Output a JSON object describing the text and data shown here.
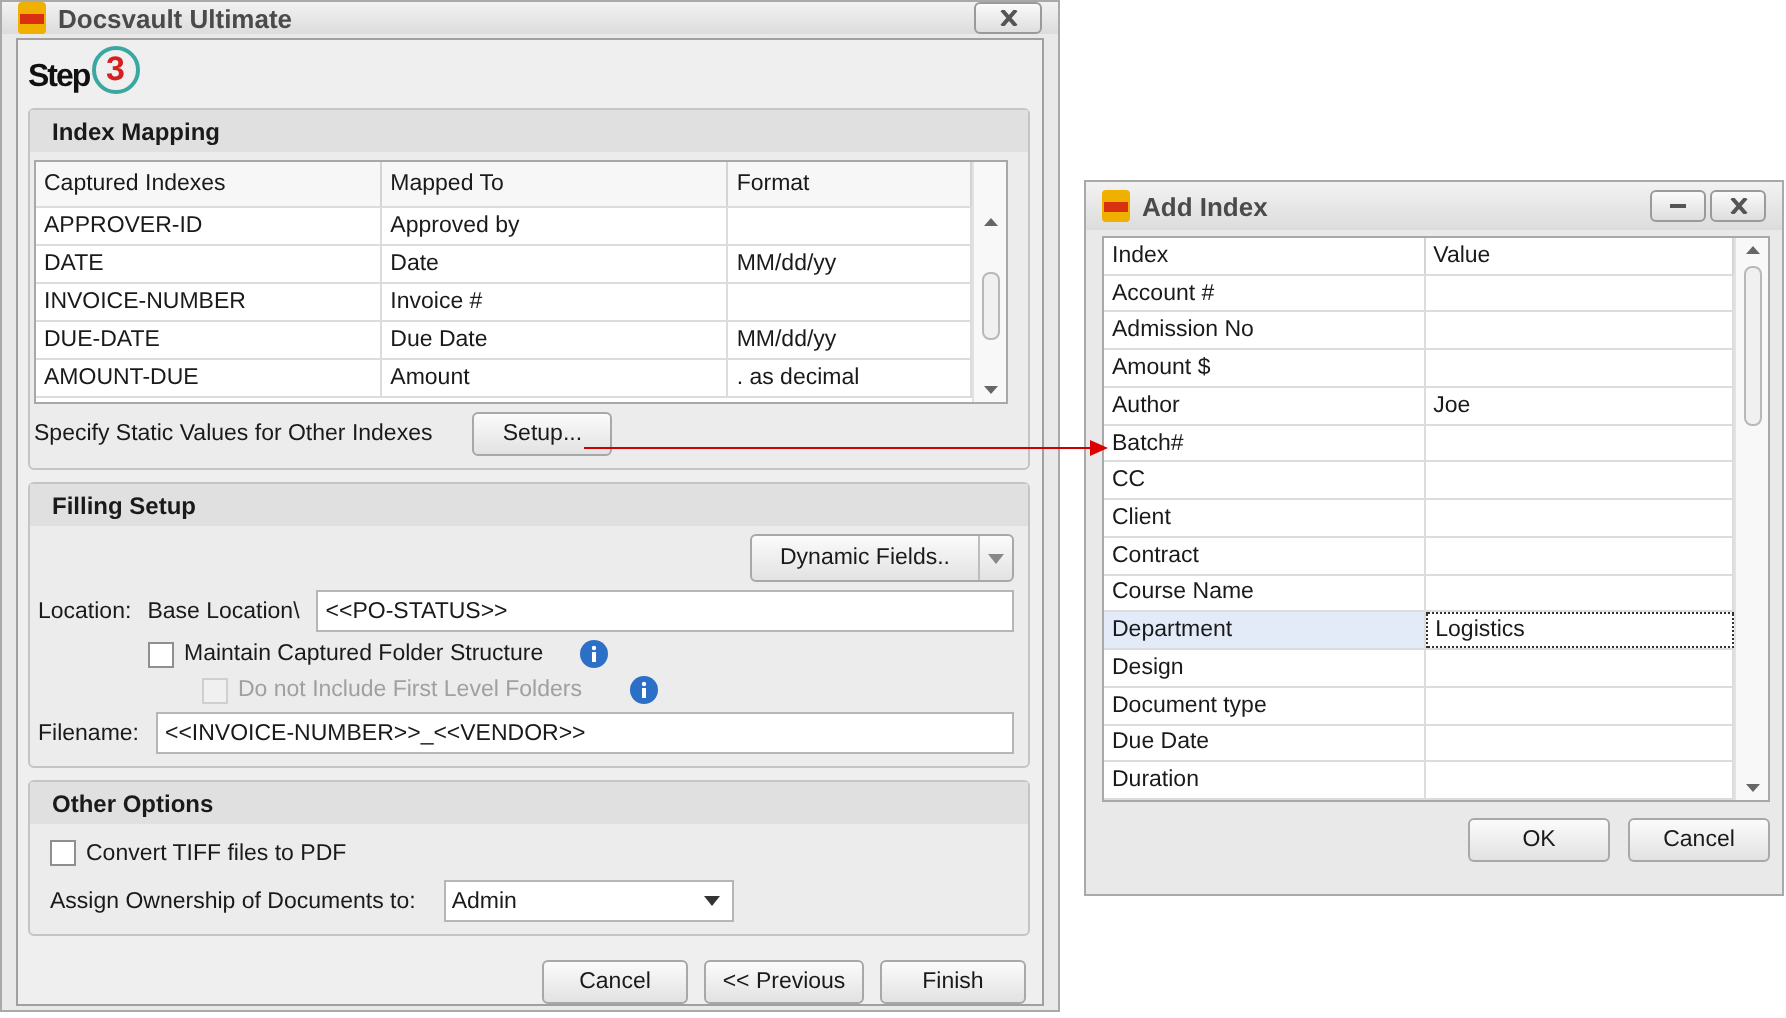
{
  "main_window": {
    "title": "Docsvault Ultimate",
    "step_label": "Step",
    "step_number": "3",
    "index_mapping": {
      "title": "Index Mapping",
      "columns": [
        "Captured Indexes",
        "Mapped To",
        "Format"
      ],
      "rows": [
        {
          "captured": "APPROVER-ID",
          "mapped": "Approved by"
        },
        {
          "captured": "DATE",
          "mapped": "Date",
          "format": "MM/dd/yy"
        },
        {
          "captured": "INVOICE-NUMBER",
          "mapped": "Invoice #"
        },
        {
          "captured": "DUE-DATE",
          "mapped": "Due Date",
          "format": "MM/dd/yy"
        },
        {
          "captured": "AMOUNT-DUE",
          "mapped": "Amount",
          "format": ". as decimal"
        }
      ],
      "static_label": "Specify Static Values for Other Indexes",
      "setup_button": "Setup..."
    },
    "filing_setup": {
      "title": "Filling Setup",
      "dynamic_fields_button": "Dynamic Fields..",
      "location_label": "Location:",
      "base_location": "Base Location\\",
      "location_value": "<<PO-STATUS>>",
      "options": [
        {
          "label": "Maintain Captured Folder Structure",
          "checked": false,
          "disabled": false,
          "children": [
            {
              "label": "Do not Include First Level Folders",
              "checked": false,
              "disabled": true
            }
          ]
        }
      ],
      "filename_label": "Filename:",
      "filename_value": "<<INVOICE-NUMBER>>_<<VENDOR>>"
    },
    "other_options": {
      "title": "Other Options",
      "convert": {
        "label": "Convert TIFF files to PDF",
        "checked": false
      },
      "ownership_label": "Assign Ownership of Documents to:",
      "ownership_value": "Admin"
    },
    "buttons": [
      "Cancel",
      "<< Previous",
      "Finish"
    ]
  },
  "add_index_window": {
    "title": "Add Index",
    "columns": [
      "Index",
      "Value"
    ],
    "rows": [
      {
        "index": "Account #",
        "selected": false
      },
      {
        "index": "Admission No",
        "selected": false
      },
      {
        "index": "Amount $",
        "selected": false
      },
      {
        "index": "Author",
        "value": "Joe",
        "selected": false
      },
      {
        "index": "Batch#",
        "selected": false
      },
      {
        "index": "CC",
        "selected": false
      },
      {
        "index": "Client",
        "selected": false
      },
      {
        "index": "Contract",
        "selected": false
      },
      {
        "index": "Course Name",
        "selected": false
      },
      {
        "index": "Department",
        "value": "Logistics",
        "selected": true
      },
      {
        "index": "Design",
        "selected": false
      },
      {
        "index": "Document type",
        "selected": false
      },
      {
        "index": "Due Date",
        "selected": false
      },
      {
        "index": "Duration",
        "selected": false
      }
    ],
    "buttons": [
      "OK",
      "Cancel"
    ]
  }
}
